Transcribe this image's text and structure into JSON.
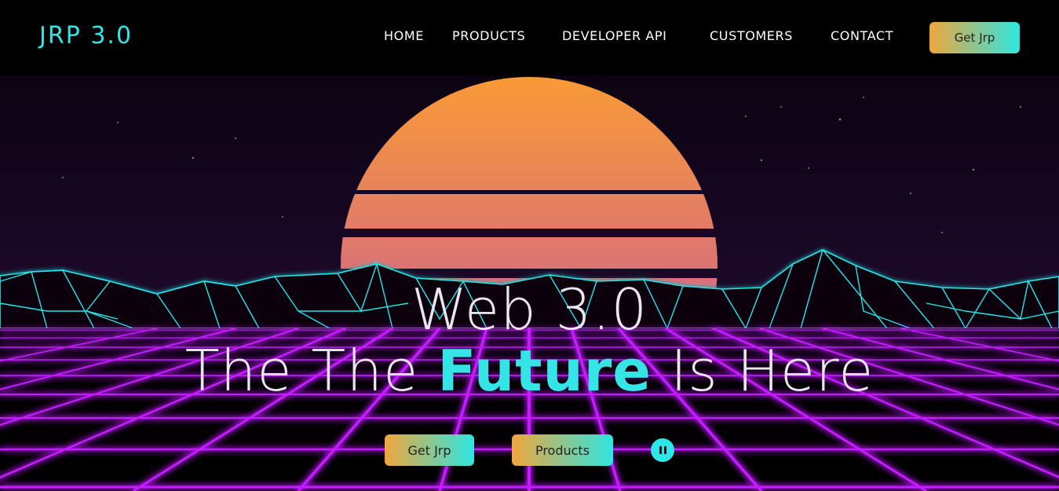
{
  "header": {
    "logo": "JRP 3.0",
    "nav": [
      "HOME",
      "PRODUCTS",
      "DEVELOPER API",
      "CUSTOMERS",
      "CONTACT"
    ],
    "cta_label": "Get Jrp"
  },
  "hero": {
    "line1": "Web 3.0",
    "line2_prefix": "The The ",
    "line2_accent": "Future",
    "line2_suffix": " Is Here",
    "primary_button": "Get Jrp",
    "secondary_button": "Products",
    "pause_icon": "pause-icon"
  },
  "colors": {
    "accent": "#35e4e4",
    "gradient_start": "#f0a63c",
    "gradient_end": "#2ee6e0",
    "grid": "#c21bff",
    "mountain_neon": "#1fe9ea"
  }
}
